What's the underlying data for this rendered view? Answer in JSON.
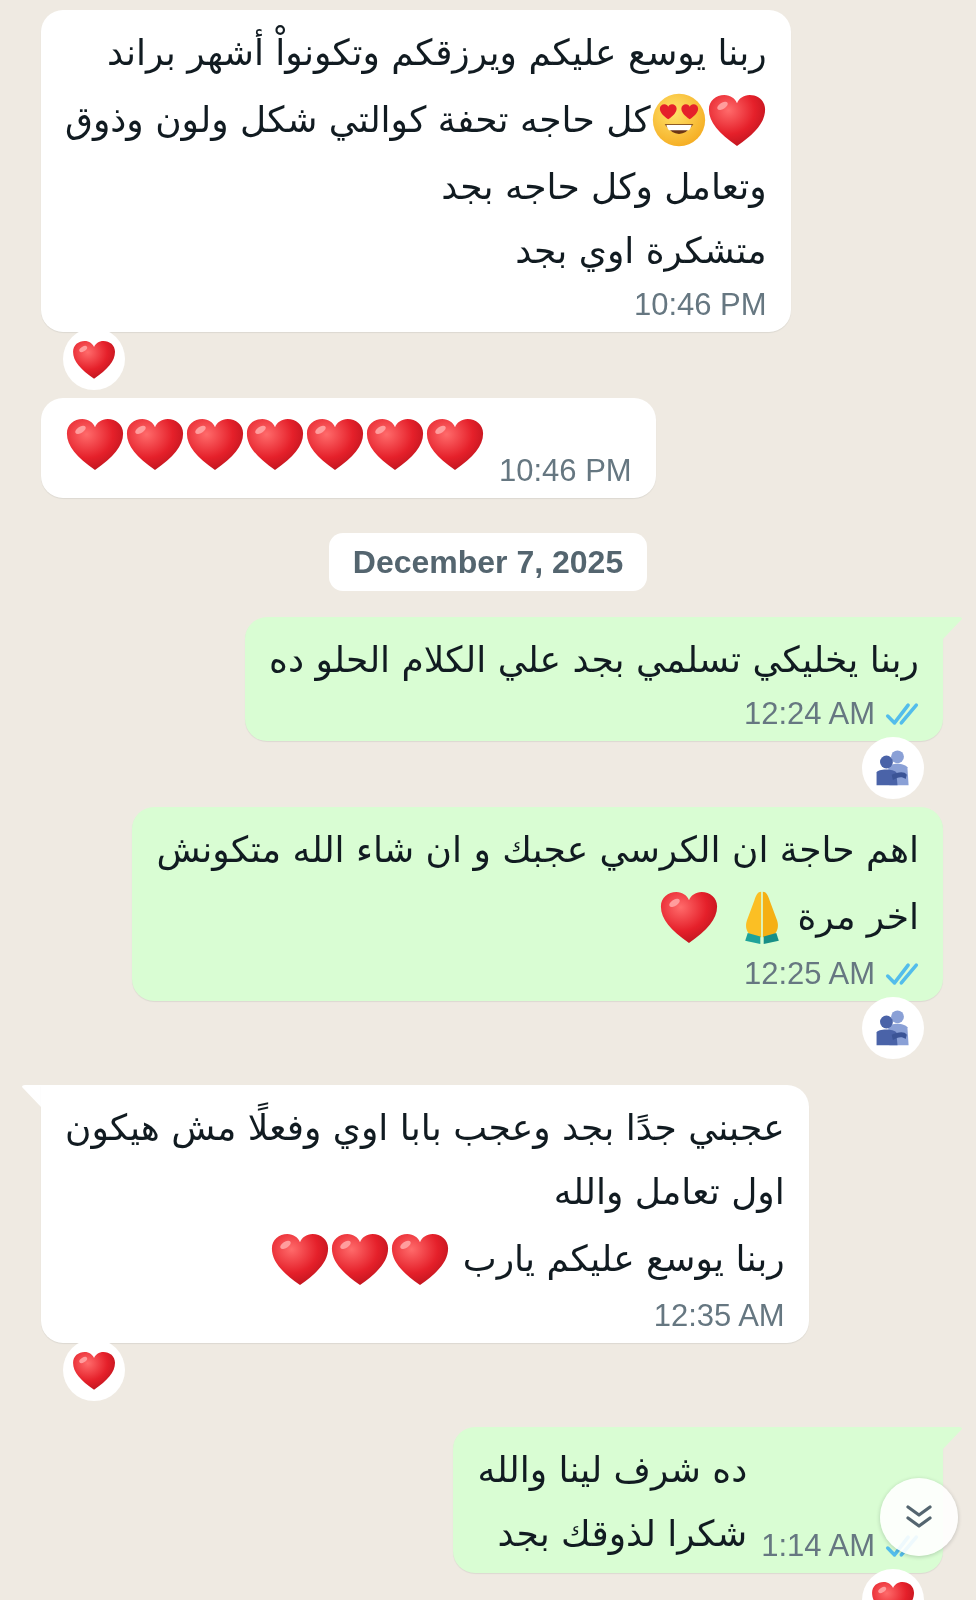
{
  "chat": {
    "messages": [
      {
        "kind": "message",
        "outgoing": false,
        "tail": false,
        "lines": [
          [
            {
              "kind": "text",
              "text": "ربنا يوسع عليكم ويرزقكم وتكونواْ أشهر براند"
            }
          ],
          [
            {
              "kind": "heart"
            },
            {
              "kind": "loveface"
            },
            {
              "kind": "text",
              "text": "كل حاجه تحفة كوالتي شكل ولون وذوق"
            }
          ],
          [
            {
              "kind": "text",
              "text": "وتعامل وكل حاجه بجد"
            }
          ],
          [
            {
              "kind": "text",
              "text": "متشكرة اوي بجد"
            }
          ]
        ],
        "time": "10:46 PM",
        "reactions": [
          {
            "kind": "heart"
          }
        ]
      },
      {
        "kind": "message",
        "outgoing": false,
        "tail": false,
        "lines": [
          [
            {
              "kind": "heart"
            },
            {
              "kind": "heart"
            },
            {
              "kind": "heart"
            },
            {
              "kind": "heart"
            },
            {
              "kind": "heart"
            },
            {
              "kind": "heart"
            },
            {
              "kind": "heart"
            }
          ]
        ],
        "time": "10:46 PM"
      },
      {
        "kind": "date",
        "text": "December 7, 2025"
      },
      {
        "kind": "message",
        "outgoing": true,
        "tail": true,
        "lines": [
          [
            {
              "kind": "text",
              "text": "ربنا يخليكي تسلمي بجد علي الكلام الحلو ده"
            }
          ]
        ],
        "time": "12:24 AM",
        "read": true,
        "reactions": [
          {
            "kind": "hug"
          }
        ]
      },
      {
        "kind": "message",
        "outgoing": true,
        "tail": false,
        "lines": [
          [
            {
              "kind": "text",
              "text": "اهم حاجة ان الكرسي عجبك و ان شاء الله متكونش"
            }
          ],
          [
            {
              "kind": "text",
              "text": "اخر مرة"
            },
            {
              "kind": "pray"
            },
            {
              "kind": "heart"
            }
          ]
        ],
        "time": "12:25 AM",
        "read": true,
        "reactions": [
          {
            "kind": "hug"
          }
        ]
      },
      {
        "kind": "message",
        "outgoing": false,
        "tail": true,
        "lines": [
          [
            {
              "kind": "text",
              "text": "عجبني جدًا بجد وعجب بابا اوي وفعلًا مش هيكون"
            }
          ],
          [
            {
              "kind": "text",
              "text": "اول تعامل والله"
            }
          ],
          [
            {
              "kind": "text",
              "text": "ربنا يوسع عليكم يارب"
            },
            {
              "kind": "heart"
            },
            {
              "kind": "heart"
            },
            {
              "kind": "heart"
            }
          ]
        ],
        "time": "12:35 AM",
        "reactions": [
          {
            "kind": "heart"
          }
        ]
      },
      {
        "kind": "message",
        "outgoing": true,
        "tail": true,
        "lines": [
          [
            {
              "kind": "text",
              "text": "ده شرف لينا والله"
            }
          ],
          [
            {
              "kind": "text",
              "text": "شكرا لذوقك بجد"
            }
          ]
        ],
        "time": "1:14 AM",
        "read": true,
        "reactions": [
          {
            "kind": "heart"
          }
        ]
      }
    ]
  },
  "scroll_down_button": true
}
